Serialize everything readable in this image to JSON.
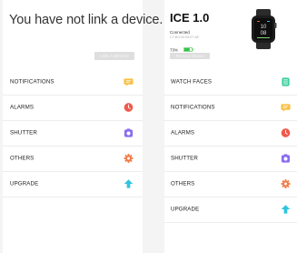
{
  "left_panel": {
    "title": "You have not link a device.",
    "link_button": "LINK A DEVICE",
    "menu": [
      {
        "label": "NOTIFICATIONS",
        "icon": "message-icon",
        "color": "#f7c044"
      },
      {
        "label": "ALARMS",
        "icon": "clock-icon",
        "color": "#f05a4e"
      },
      {
        "label": "SHUTTER",
        "icon": "camera-icon",
        "color": "#8a6df0"
      },
      {
        "label": "OTHERS",
        "icon": "gear-icon",
        "color": "#f27a45"
      },
      {
        "label": "UPGRADE",
        "icon": "upgrade-icon",
        "color": "#2ec4e0"
      }
    ]
  },
  "right_panel": {
    "device_name": "ICE 1.0",
    "status": "Connected",
    "mac": "C7:B0:00:09:07:AF",
    "battery": "73%",
    "battery_level": 0.73,
    "battery_color": "#38c24a",
    "remove_button": "Remove device",
    "menu": [
      {
        "label": "WATCH FACES",
        "icon": "watch-face-icon",
        "color": "#3ccf9e"
      },
      {
        "label": "NOTIFICATIONS",
        "icon": "message-icon",
        "color": "#f7c044"
      },
      {
        "label": "ALARMS",
        "icon": "clock-icon",
        "color": "#f05a4e"
      },
      {
        "label": "SHUTTER",
        "icon": "camera-icon",
        "color": "#8a6df0"
      },
      {
        "label": "OTHERS",
        "icon": "gear-icon",
        "color": "#f27a45"
      },
      {
        "label": "UPGRADE",
        "icon": "upgrade-icon",
        "color": "#2ec4e0"
      }
    ]
  }
}
